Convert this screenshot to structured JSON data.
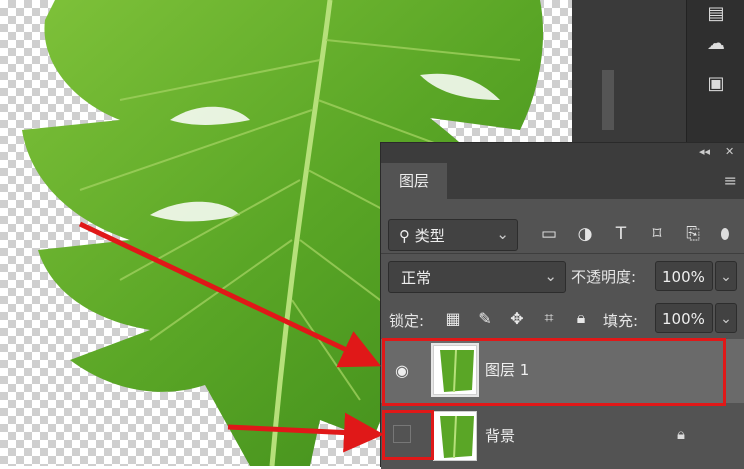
{
  "canvas": {
    "content": "monstera leaf on transparent background"
  },
  "right_toolbar": {
    "icons": [
      "tool-icon",
      "creative-cloud-icon",
      "library-icon"
    ]
  },
  "layers_panel": {
    "tab_label": "图层",
    "filter": {
      "label": "类型",
      "icon": "search-icon"
    },
    "filter_icons": [
      "image-filter-icon",
      "adjustment-filter-icon",
      "text-filter-icon",
      "shape-filter-icon",
      "smart-object-filter-icon"
    ],
    "blend_mode": "正常",
    "opacity_label": "不透明度:",
    "opacity_value": "100%",
    "lock_label": "锁定:",
    "fill_label": "填充:",
    "fill_value": "100%",
    "layers": [
      {
        "name": "图层 1",
        "visible": true,
        "selected": true
      },
      {
        "name": "背景",
        "visible": false,
        "selected": false,
        "locked": true
      }
    ]
  },
  "annotations": {
    "arrow_color": "#e01818",
    "highlight_color": "#e01818"
  }
}
